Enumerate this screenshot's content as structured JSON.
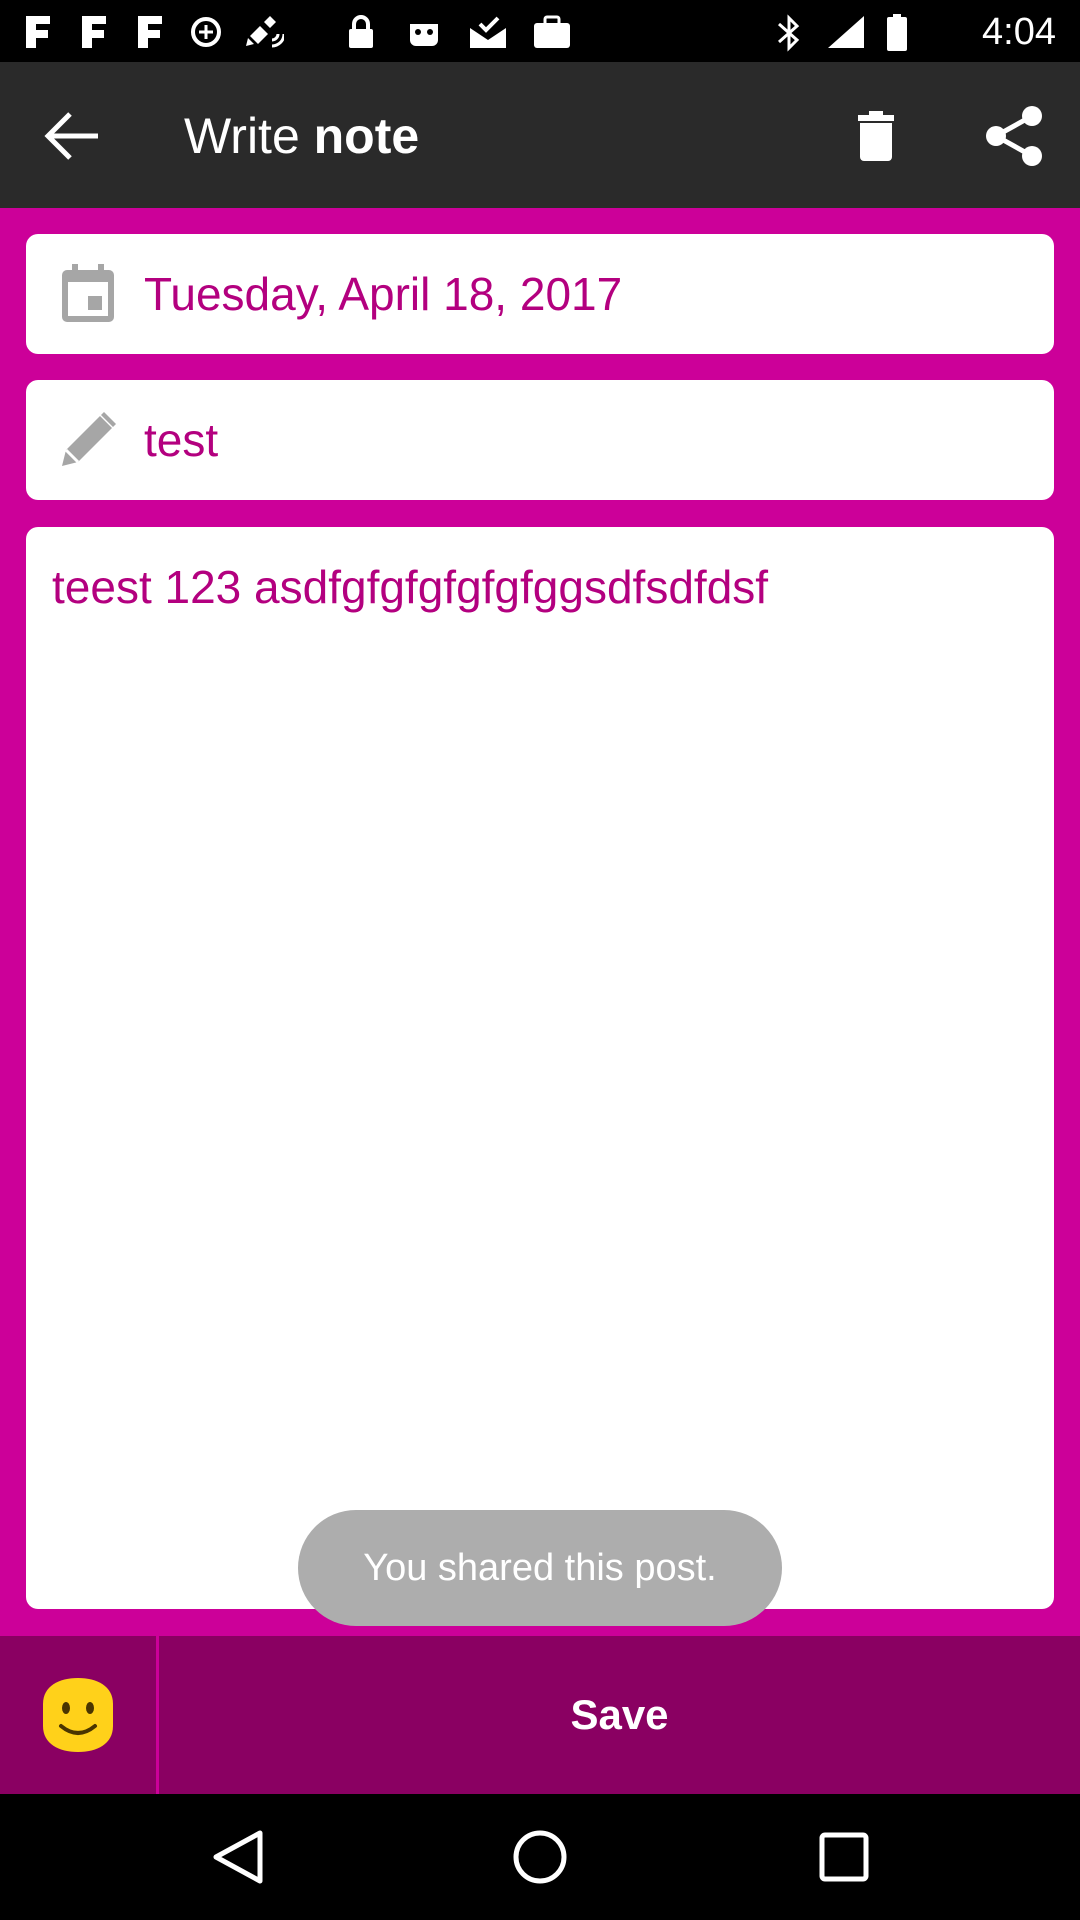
{
  "status_bar": {
    "time": "4:04",
    "icons": [
      "fake-gps-icon",
      "fake-gps-icon",
      "fake-gps-icon",
      "data-saver-icon",
      "satellite-icon",
      "lock-icon",
      "android-icon",
      "mail-check-icon",
      "briefcase-icon",
      "bluetooth-icon",
      "signal-icon",
      "battery-icon"
    ]
  },
  "toolbar": {
    "title_regular": "Write ",
    "title_bold": "note",
    "icons": {
      "back": "back-arrow-icon",
      "delete": "trash-icon",
      "share": "share-icon"
    }
  },
  "form": {
    "date": "Tuesday, April 18, 2017",
    "title": "test",
    "note": "teest 123 asdfgfgfgfgfgfggsdfsdfdsf"
  },
  "toast": {
    "message": "You shared this post."
  },
  "bottom_bar": {
    "save_label": "Save",
    "emoji_icon": "smiley-icon"
  },
  "nav": {
    "icons": [
      "back-triangle-icon",
      "home-circle-icon",
      "recents-square-icon"
    ]
  },
  "colors": {
    "accent": "#cc0099",
    "accent_dark": "#8a0062",
    "text_accent": "#b3007f",
    "toolbar": "#2a2a2a",
    "toast": "#adadad",
    "emoji": "#ffd11a"
  }
}
